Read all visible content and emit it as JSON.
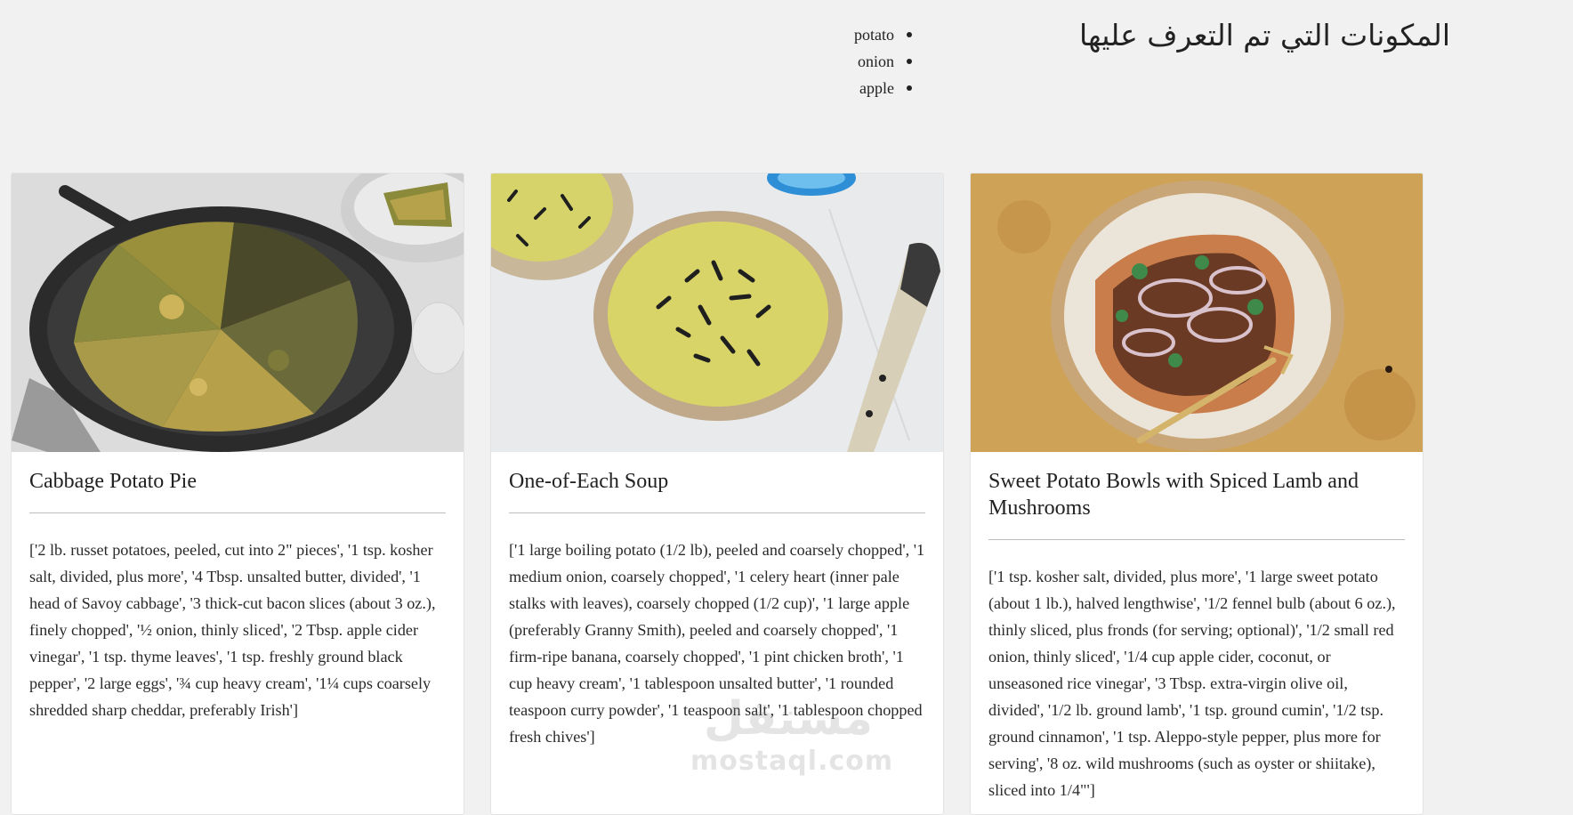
{
  "page": {
    "title": "المكونات التي تم التعرف عليها"
  },
  "ingredients": [
    "potato",
    "onion",
    "apple"
  ],
  "recipes": [
    {
      "title": "Cabbage Potato Pie",
      "image_icon": "frittata-skillet-photo",
      "ingredients_text": "['2 lb. russet potatoes, peeled, cut into 2\" pieces', '1 tsp. kosher salt, divided, plus more', '4 Tbsp. unsalted butter, divided', '1 head of Savoy cabbage', '3 thick-cut bacon slices (about 3 oz.), finely chopped', '½ onion, thinly sliced', '2 Tbsp. apple cider vinegar', '1 tsp. thyme leaves', '1 tsp. freshly ground black pepper', '2 large eggs', '¾ cup heavy cream', '1¼ cups coarsely shredded sharp cheddar, preferably Irish']"
    },
    {
      "title": "One-of-Each Soup",
      "image_icon": "green-soup-bowl-photo",
      "ingredients_text": "['1 large boiling potato (1/2 lb), peeled and coarsely chopped', '1 medium onion, coarsely chopped', '1 celery heart (inner pale stalks with leaves), coarsely chopped (1/2 cup)', '1 large apple (preferably Granny Smith), peeled and coarsely chopped', '1 firm-ripe banana, coarsely chopped', '1 pint chicken broth', '1 cup heavy cream', '1 tablespoon unsalted butter', '1 rounded teaspoon curry powder', '1 teaspoon salt', '1 tablespoon chopped fresh chives']"
    },
    {
      "title": "Sweet Potato Bowls with Spiced Lamb and Mushrooms",
      "image_icon": "sweet-potato-plate-photo",
      "ingredients_text": "['1 tsp. kosher salt, divided, plus more', '1 large sweet potato (about 1 lb.), halved lengthwise', '1/2 fennel bulb (about 6 oz.), thinly sliced, plus fronds (for serving; optional)', '1/2 small red onion, thinly sliced', '1/4 cup apple cider, coconut, or unseasoned rice vinegar', '3 Tbsp. extra-virgin olive oil, divided', '1/2 lb. ground lamb', '1 tsp. ground cumin', '1/2 tsp. ground cinnamon', '1 tsp. Aleppo-style pepper, plus more for serving', '8 oz. wild mushrooms (such as oyster or shiitake), sliced into 1/4\"']"
    }
  ],
  "watermark": {
    "arabic": "مستقل",
    "latin": "mostaql.com"
  },
  "colors": {
    "background": "#f1f1f1",
    "card": "#ffffff",
    "divider": "#bdbdbd"
  }
}
